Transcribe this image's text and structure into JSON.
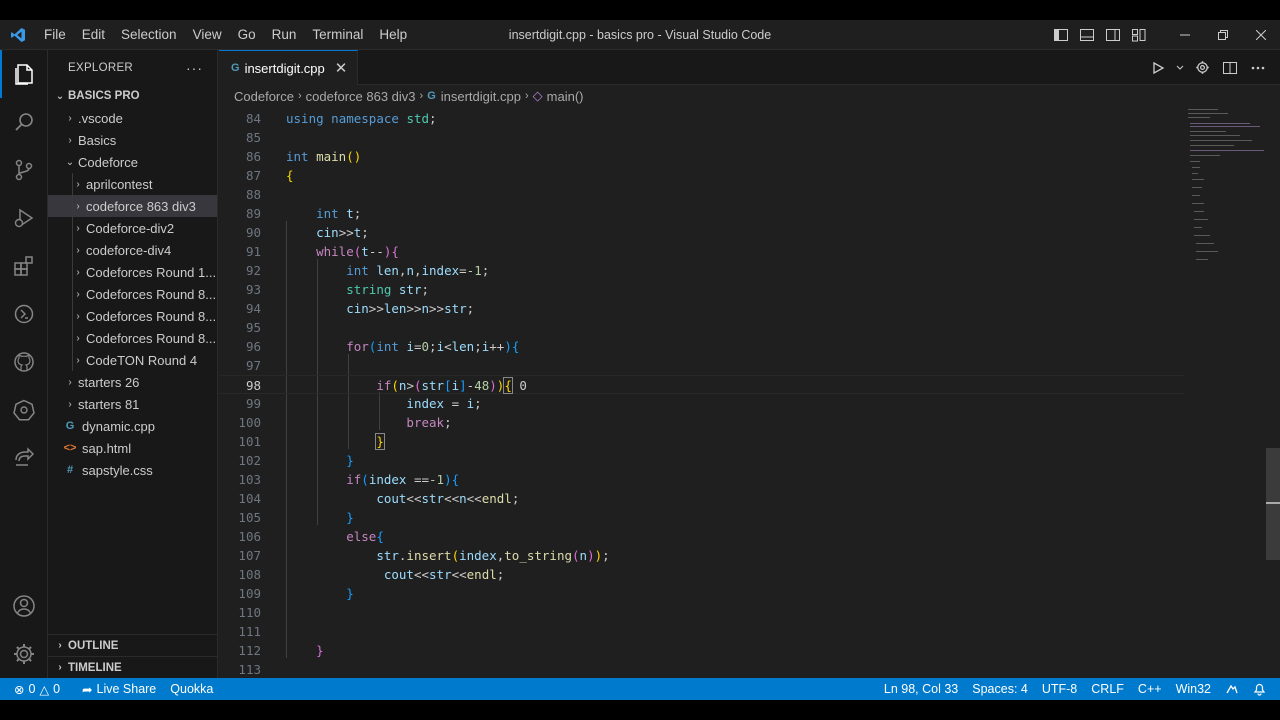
{
  "window": {
    "title": "insertdigit.cpp - basics pro - Visual Studio Code",
    "menu": [
      "File",
      "Edit",
      "Selection",
      "View",
      "Go",
      "Run",
      "Terminal",
      "Help"
    ]
  },
  "sidebar": {
    "title": "EXPLORER",
    "more": "···",
    "root": "BASICS PRO",
    "items": [
      {
        "label": ".vscode",
        "type": "folder",
        "expanded": false
      },
      {
        "label": "Basics",
        "type": "folder",
        "expanded": false
      },
      {
        "label": "Codeforce",
        "type": "folder",
        "expanded": true
      },
      {
        "label": "aprilcontest",
        "type": "folder",
        "expanded": false
      },
      {
        "label": "codeforce 863 div3",
        "type": "folder",
        "expanded": false,
        "selected": true
      },
      {
        "label": "Codeforce-div2",
        "type": "folder",
        "expanded": false
      },
      {
        "label": "codeforce-div4",
        "type": "folder",
        "expanded": false
      },
      {
        "label": "Codeforces Round 1...",
        "type": "folder",
        "expanded": false
      },
      {
        "label": "Codeforces Round 8...",
        "type": "folder",
        "expanded": false
      },
      {
        "label": "Codeforces Round 8...",
        "type": "folder",
        "expanded": false
      },
      {
        "label": "Codeforces Round 8...",
        "type": "folder",
        "expanded": false
      },
      {
        "label": "CodeTON Round 4",
        "type": "folder",
        "expanded": false
      },
      {
        "label": "starters 26",
        "type": "folder",
        "expanded": false
      },
      {
        "label": "starters 81",
        "type": "folder",
        "expanded": false
      },
      {
        "label": "dynamic.cpp",
        "type": "cpp"
      },
      {
        "label": "sap.html",
        "type": "html"
      },
      {
        "label": "sapstyle.css",
        "type": "css"
      }
    ],
    "outline": "OUTLINE",
    "timeline": "TIMELINE"
  },
  "editor": {
    "tab": "insertdigit.cpp",
    "breadcrumb": [
      "Codeforce",
      "codeforce 863 div3",
      "insertdigit.cpp",
      "main()"
    ],
    "current_line": 98,
    "line_numbers": [
      "84",
      "85",
      "86",
      "87",
      "88",
      "89",
      "90",
      "91",
      "92",
      "93",
      "94",
      "95",
      "96",
      "97",
      "98",
      "99",
      "100",
      "101",
      "102",
      "103",
      "104",
      "105",
      "106",
      "107",
      "108",
      "109",
      "110",
      "111",
      "112",
      "113"
    ],
    "inlay_hint": "0"
  },
  "statusbar": {
    "errors": "0",
    "warnings": "0",
    "live_share": "Live Share",
    "quokka": "Quokka",
    "position": "Ln 98, Col 33",
    "spaces": "Spaces: 4",
    "encoding": "UTF-8",
    "eol": "CRLF",
    "language": "C++",
    "platform": "Win32"
  },
  "colors": {
    "accent": "#007acc",
    "editor_bg": "#1f1f1f",
    "keyword": "#569cd6",
    "control": "#c586c0",
    "function": "#dcdcaa",
    "variable": "#9cdcfe",
    "number": "#b5cea8"
  },
  "icons": [
    "vscode-logo-icon",
    "files-icon",
    "search-icon",
    "source-control-icon",
    "run-debug-icon",
    "extensions-icon",
    "remote-icon",
    "github-icon",
    "kubernetes-icon",
    "live-share-icon",
    "account-icon",
    "settings-gear-icon",
    "run-icon",
    "split-editor-icon",
    "more-icon"
  ]
}
